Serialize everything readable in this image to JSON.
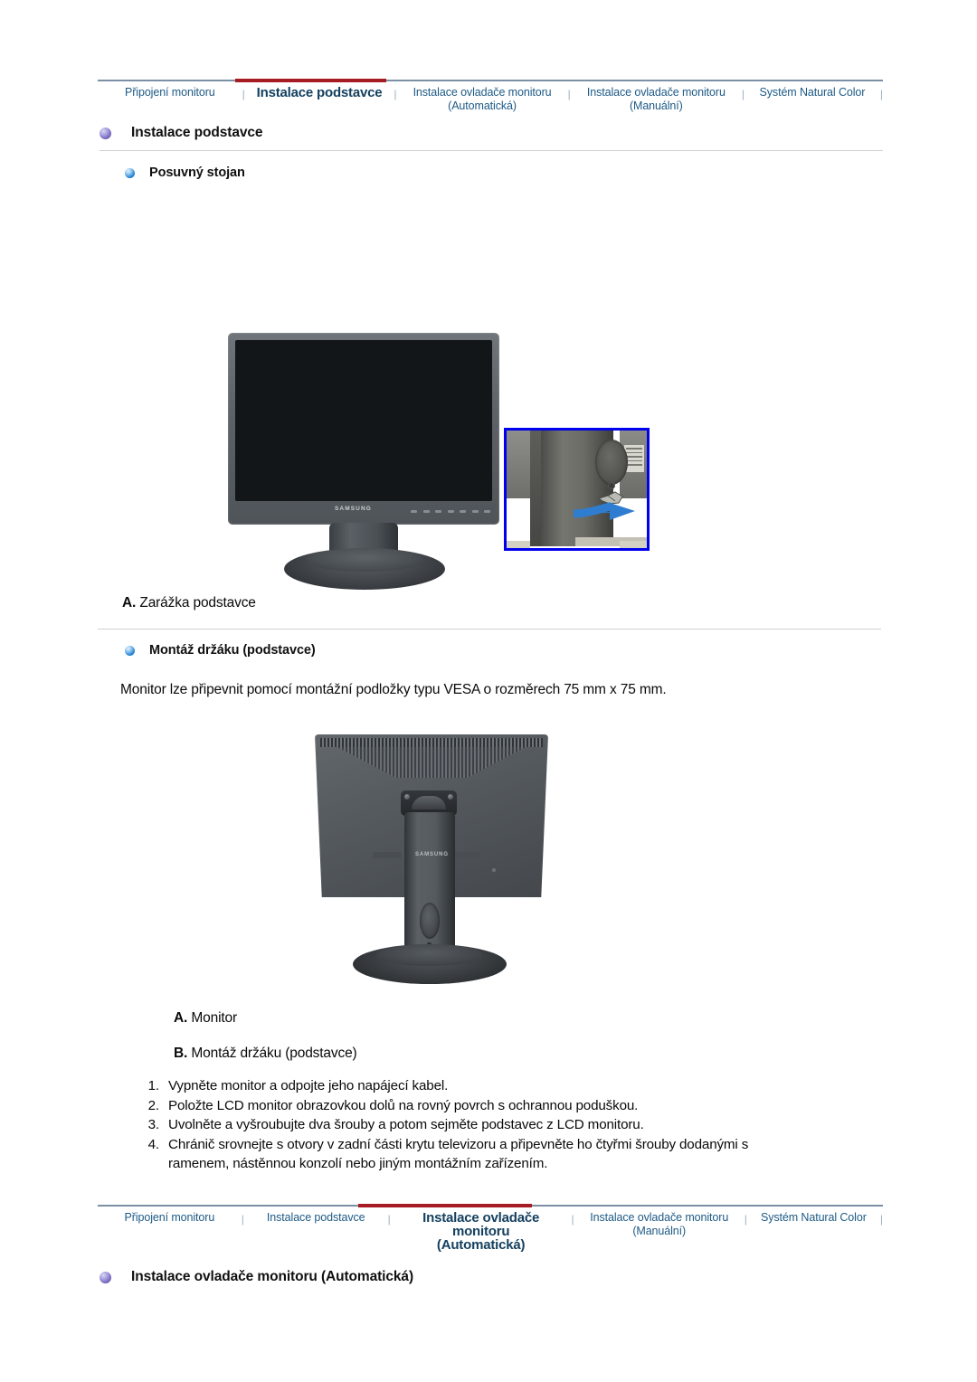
{
  "top_nav": {
    "items": [
      {
        "label": "Připojení monitoru",
        "active": false
      },
      {
        "label": "Instalace podstavce",
        "active": true
      },
      {
        "label": "Instalace ovladače monitoru\n(Automatická)",
        "active": false
      },
      {
        "label": "Instalace ovladače monitoru\n(Manuální)",
        "active": false
      },
      {
        "label": "Systém Natural Color",
        "active": false
      }
    ],
    "separator": "|",
    "accent_color": "#a61c22",
    "link_color": "#1d5a86",
    "rule_color": "#7b8fa5"
  },
  "section1": {
    "heading": "Instalace podstavce",
    "subheading": "Posuvný stojan",
    "caption": {
      "letter": "A.",
      "text": "Zarážka podstavce"
    },
    "figure_front": {
      "brand": "SAMSUNG",
      "detail_border_color": "#0000ee",
      "arrow_color": "#2e7dd1"
    }
  },
  "section2": {
    "subheading": "Montáž držáku (podstavce)",
    "intro": "Monitor lze připevnit pomocí montážní podložky typu VESA o rozměrech 75 mm x 75 mm.",
    "figure_back": {
      "brand": "SAMSUNG"
    },
    "captions": [
      {
        "letter": "A.",
        "text": "Monitor"
      },
      {
        "letter": "B.",
        "text": "Montáž držáku (podstavce)"
      }
    ],
    "steps": [
      {
        "num": "1.",
        "text": "Vypněte monitor a odpojte jeho napájecí kabel."
      },
      {
        "num": "2.",
        "text": "Položte LCD monitor obrazovkou dolů na rovný povrch s ochrannou poduškou."
      },
      {
        "num": "3.",
        "text": "Uvolněte a vyšroubujte dva šrouby a potom sejměte podstavec z LCD monitoru."
      },
      {
        "num": "4.",
        "text": "Chránič srovnejte s otvory v zadní části krytu televizoru a připevněte ho čtyřmi šrouby dodanými s ramenem, nástěnnou konzolí nebo jiným montážním zařízením."
      }
    ]
  },
  "bottom_nav": {
    "items": [
      {
        "label": "Připojení monitoru",
        "active": false
      },
      {
        "label": "Instalace podstavce",
        "active": false
      },
      {
        "label": "Instalace ovladače monitoru\n(Automatická)",
        "active": true
      },
      {
        "label": "Instalace ovladače monitoru\n(Manuální)",
        "active": false
      },
      {
        "label": "Systém Natural Color",
        "active": false
      }
    ],
    "separator": "|"
  },
  "section3": {
    "heading": "Instalace ovladače monitoru (Automatická)"
  }
}
